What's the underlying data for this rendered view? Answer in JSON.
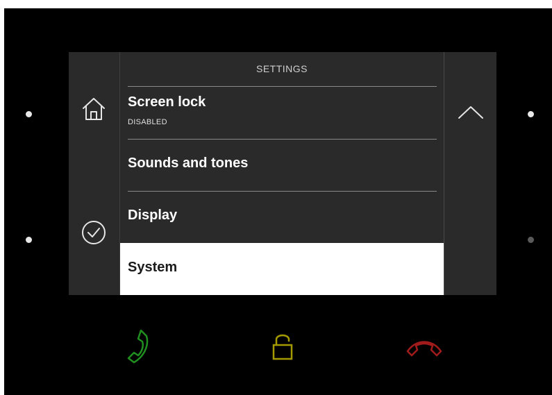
{
  "screen": {
    "title": "SETTINGS",
    "menu": [
      {
        "label": "Screen lock",
        "sublabel": "DISABLED",
        "selected": false
      },
      {
        "label": "Sounds and tones",
        "sublabel": "",
        "selected": false
      },
      {
        "label": "Display",
        "sublabel": "",
        "selected": false
      },
      {
        "label": "System",
        "sublabel": "",
        "selected": true
      }
    ]
  },
  "icons": {
    "home": "home-icon",
    "confirm": "check-circle-icon",
    "scroll_up": "chevron-up-icon",
    "call": "phone-answer-icon",
    "unlock": "unlock-icon",
    "hangup": "phone-hangup-icon"
  },
  "colors": {
    "screen_bg": "#2a2a2a",
    "selected_bg": "#ffffff",
    "call": "#1f8f1f",
    "unlock": "#a39a00",
    "hangup": "#a11b1b"
  }
}
